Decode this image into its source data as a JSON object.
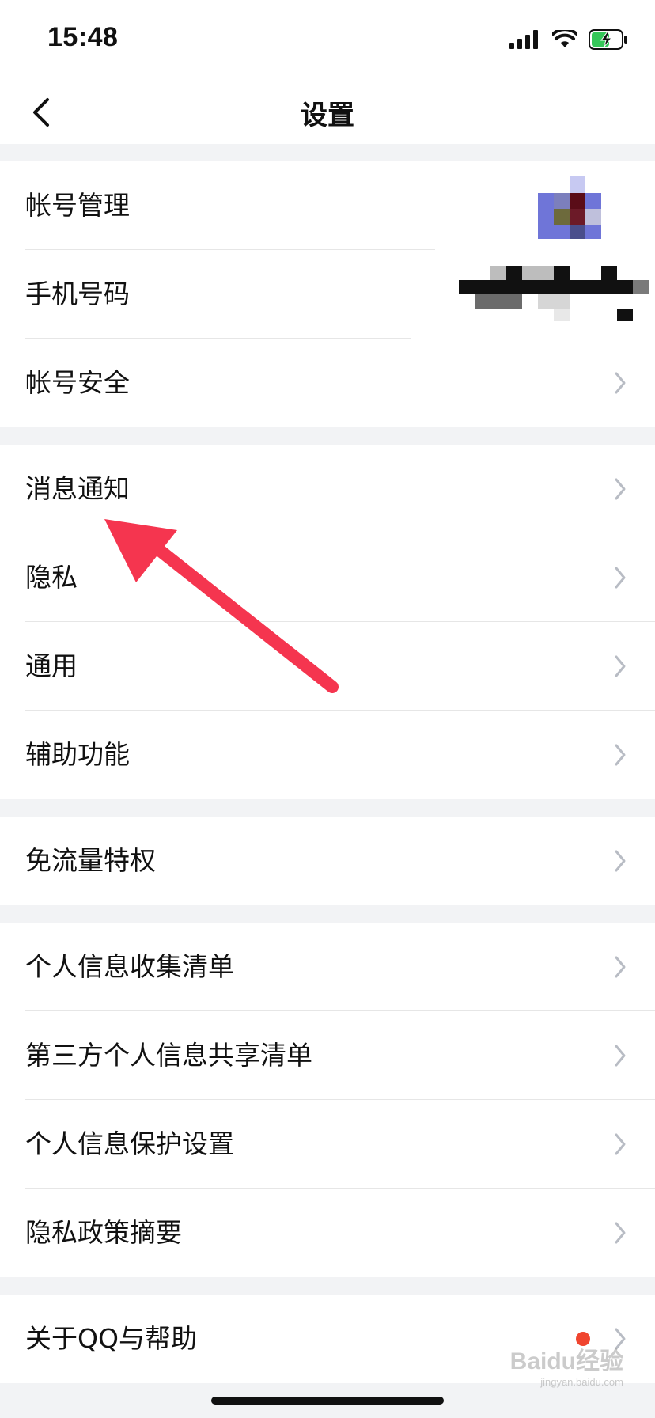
{
  "status_bar": {
    "time": "15:48",
    "icons": [
      "signal-icon",
      "wifi-icon",
      "battery-charging-icon"
    ]
  },
  "nav": {
    "title": "设置",
    "back_icon": "chevron-left-icon"
  },
  "groups": [
    {
      "items": [
        {
          "label": "帐号管理",
          "accessory": "avatar-pixelated"
        },
        {
          "label": "手机号码",
          "accessory": "phone-pixelated"
        },
        {
          "label": "帐号安全",
          "accessory": "chevron-right-icon"
        }
      ]
    },
    {
      "items": [
        {
          "label": "消息通知",
          "accessory": "chevron-right-icon"
        },
        {
          "label": "隐私",
          "accessory": "chevron-right-icon"
        },
        {
          "label": "通用",
          "accessory": "chevron-right-icon"
        },
        {
          "label": "辅助功能",
          "accessory": "chevron-right-icon"
        }
      ]
    },
    {
      "items": [
        {
          "label": "免流量特权",
          "accessory": "chevron-right-icon"
        }
      ]
    },
    {
      "items": [
        {
          "label": "个人信息收集清单",
          "accessory": "chevron-right-icon"
        },
        {
          "label": "第三方个人信息共享清单",
          "accessory": "chevron-right-icon"
        },
        {
          "label": "个人信息保护设置",
          "accessory": "chevron-right-icon"
        },
        {
          "label": "隐私政策摘要",
          "accessory": "chevron-right-icon"
        }
      ]
    },
    {
      "items": [
        {
          "label": "关于QQ与帮助",
          "accessory": "chevron-right-icon",
          "badge": "red-dot"
        }
      ]
    }
  ],
  "colors": {
    "background": "#f2f3f5",
    "row": "#ffffff",
    "arrow": "#f5354f",
    "badge": "#f0452f"
  },
  "watermark": {
    "brand": "Baidu经验",
    "url": "jingyan.baidu.com"
  }
}
